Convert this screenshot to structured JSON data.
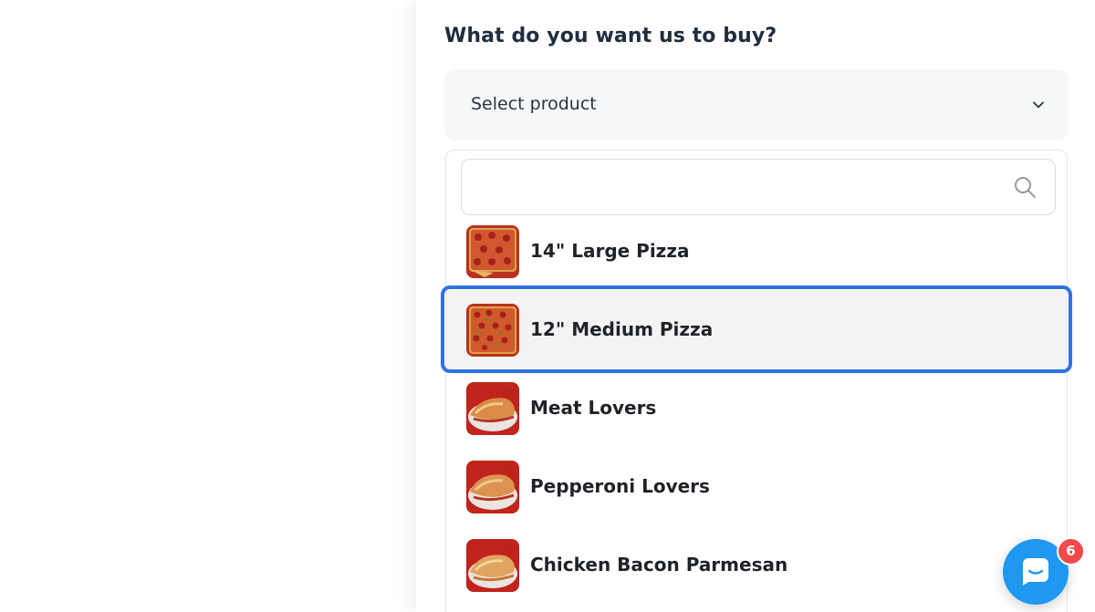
{
  "form": {
    "question": "What do you want us to buy?",
    "select_placeholder": "Select product"
  },
  "dropdown": {
    "search_value": "",
    "search_icon": "search-icon",
    "options": [
      {
        "label": "14\" Large Pizza",
        "thumb": "pizza-square-image"
      },
      {
        "label": "12\" Medium Pizza",
        "thumb": "pizza-square-image",
        "highlighted": true
      },
      {
        "label": "Meat Lovers",
        "thumb": "calzone-image"
      },
      {
        "label": "Pepperoni Lovers",
        "thumb": "calzone-image"
      },
      {
        "label": "Chicken Bacon Parmesan",
        "thumb": "calzone-image"
      }
    ]
  },
  "chat": {
    "icon": "chat-icon",
    "badge_count": "6"
  },
  "colors": {
    "highlight_ring": "#2f73e0",
    "chat_button": "#1e98f0",
    "badge": "#f04a4a",
    "select_bg": "#f6f7f9"
  }
}
